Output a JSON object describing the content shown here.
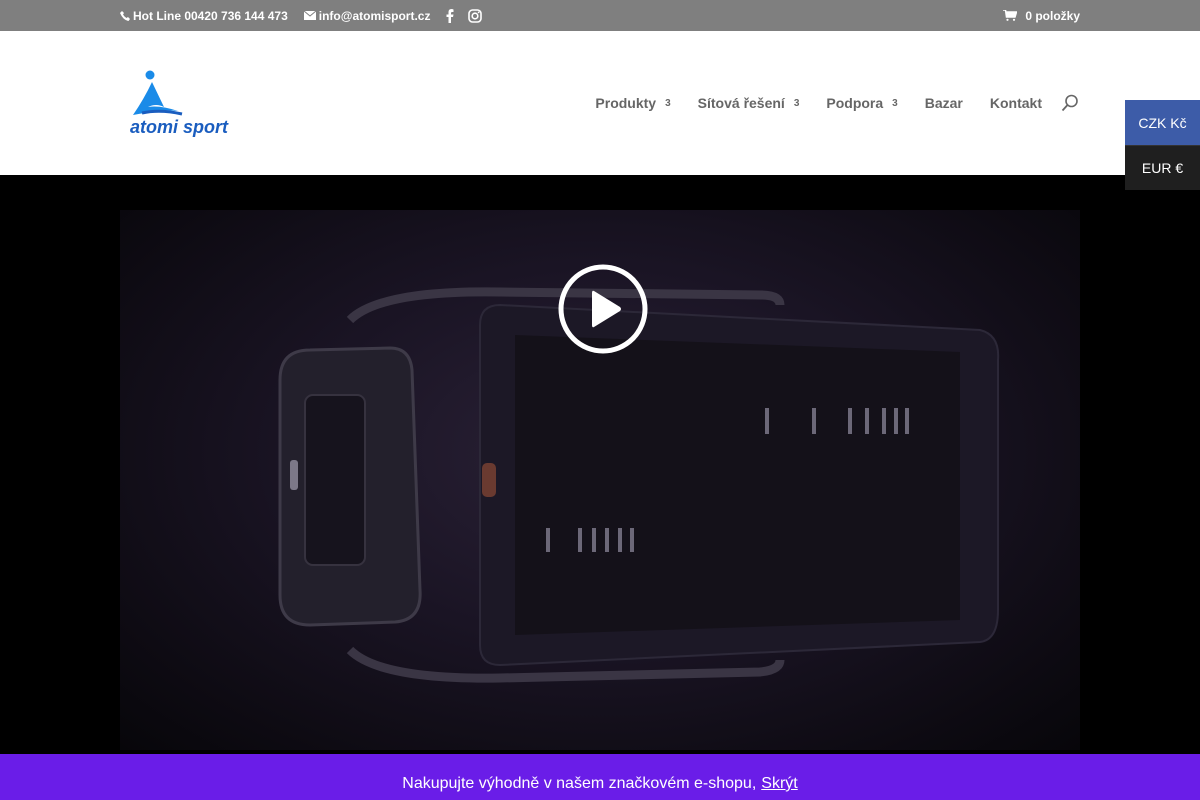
{
  "topbar": {
    "hotline": "Hot Line 00420 736 144 473",
    "email": "info@atomisport.cz",
    "cart": "0 položky"
  },
  "logo": {
    "text": "atomi sport"
  },
  "nav": {
    "items": [
      {
        "label": "Produkty",
        "has_dropdown": true
      },
      {
        "label": "Sítová řešení",
        "has_dropdown": true
      },
      {
        "label": "Podpora",
        "has_dropdown": true
      },
      {
        "label": "Bazar",
        "has_dropdown": false
      },
      {
        "label": "Kontakt",
        "has_dropdown": false
      }
    ],
    "chevron": "3"
  },
  "currency": {
    "options": [
      "CZK Kč",
      "EUR €"
    ],
    "selected": "CZK Kč"
  },
  "video": {
    "state": "paused"
  },
  "cookie": {
    "text": "Nakupujte výhodně v našem značkovém e-shopu,",
    "hide_link": "Skrýt"
  },
  "colors": {
    "topbar": "#7f7f7f",
    "accent": "#3d5ca8",
    "cookie_bar": "#6a1de8",
    "logo_blue": "#1a8be8"
  }
}
